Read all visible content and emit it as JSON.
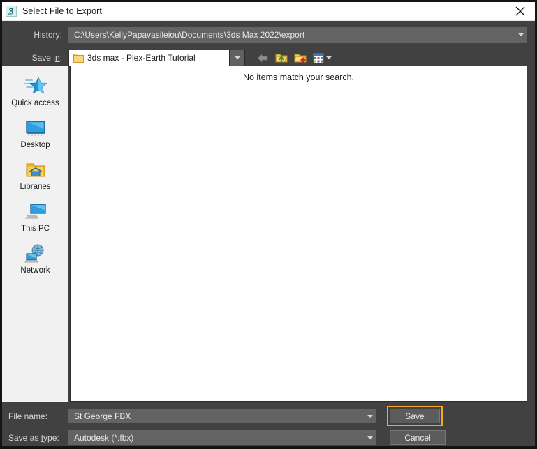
{
  "window": {
    "title": "Select File to Export",
    "app_icon": "3ds-max-icon",
    "close_icon": "close-icon"
  },
  "history": {
    "label": "History:",
    "value": "C:\\Users\\KellyPapavasileiou\\Documents\\3ds Max 2022\\export",
    "dropdown_icon": "chevron-down-icon"
  },
  "save_in": {
    "label_pre": "Save i",
    "label_key": "n",
    "label_post": ":",
    "value": "3ds max - Plex-Earth Tutorial",
    "folder_icon": "folder-icon",
    "dropdown_icon": "chevron-down-icon"
  },
  "toolbar": {
    "back_tooltip": "Back",
    "up_tooltip": "Up one level",
    "new_folder_tooltip": "Create New Folder",
    "views_tooltip": "Views"
  },
  "places": [
    {
      "label": "Quick access",
      "icon": "star-icon"
    },
    {
      "label": "Desktop",
      "icon": "desktop-icon"
    },
    {
      "label": "Libraries",
      "icon": "libraries-folder-icon"
    },
    {
      "label": "This PC",
      "icon": "this-pc-icon"
    },
    {
      "label": "Network",
      "icon": "network-icon"
    }
  ],
  "file_list": {
    "empty_message": "No items match your search."
  },
  "file_name": {
    "label_pre": "File ",
    "label_key": "n",
    "label_post": "ame:",
    "value": "St George FBX",
    "dropdown_icon": "chevron-down-icon"
  },
  "save_as_type": {
    "label_pre": "Save as ",
    "label_key": "t",
    "label_post": "ype:",
    "value": "Autodesk (*.fbx)",
    "dropdown_icon": "chevron-down-icon"
  },
  "buttons": {
    "save_pre": "S",
    "save_key": "a",
    "save_post": "ve",
    "cancel": "Cancel"
  },
  "colors": {
    "dialog_bg": "#414141",
    "field_bg": "#636363",
    "places_bg": "#f1f1f1",
    "list_bg": "#ffffff",
    "focus_ring": "#f5a623",
    "titlebar_bg": "#ffffff"
  }
}
